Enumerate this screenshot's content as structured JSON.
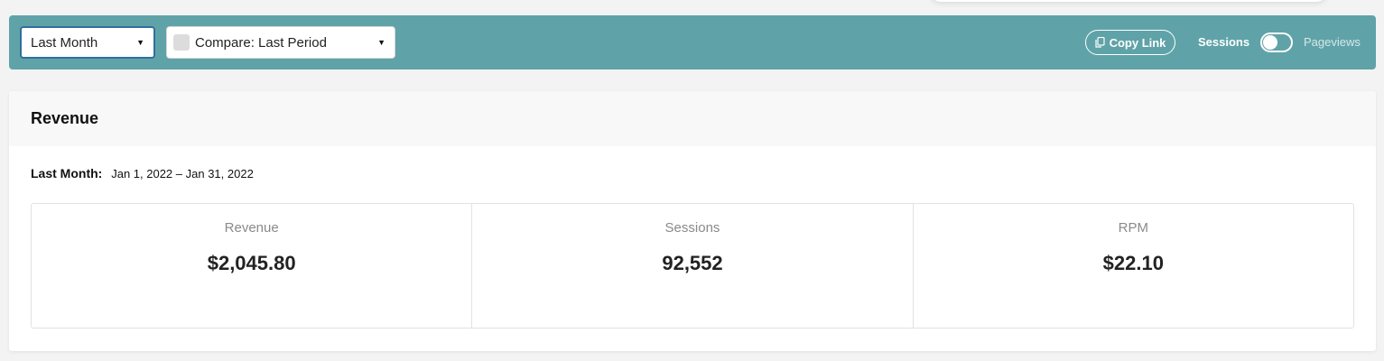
{
  "toolbar": {
    "period_select": {
      "value": "Last Month"
    },
    "compare_select": {
      "value": "Compare: Last Period"
    },
    "copy_link_label": "Copy Link",
    "toggle": {
      "left_label": "Sessions",
      "right_label": "Pageviews",
      "active": "Sessions"
    },
    "background_color": "#5fa3a8"
  },
  "card": {
    "title": "Revenue",
    "date_label": "Last Month:",
    "date_range": "Jan 1, 2022 – Jan 31, 2022",
    "stats": [
      {
        "label": "Revenue",
        "value": "$2,045.80"
      },
      {
        "label": "Sessions",
        "value": "92,552"
      },
      {
        "label": "RPM",
        "value": "$22.10"
      }
    ]
  }
}
